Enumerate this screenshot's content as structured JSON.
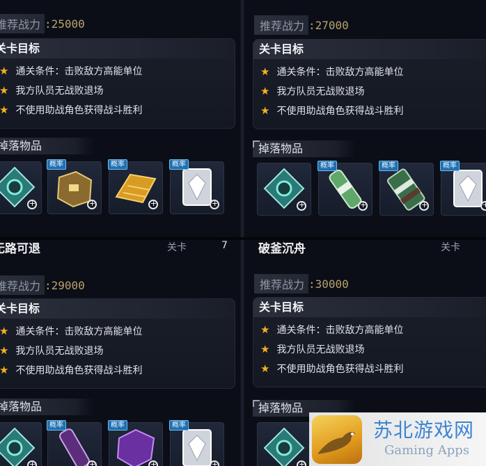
{
  "panels": [
    {
      "power_label": "推荐战力",
      "power_value": ":25000",
      "objective_title": "关卡目标",
      "objectives": [
        "通关条件：击败敌方高能单位",
        "我方队员无战败退场",
        "不使用助战角色获得战斗胜利"
      ],
      "drops_label": "掉落物品",
      "drop_items": [
        {
          "icon": "gear-chip-icon",
          "tag": ""
        },
        {
          "icon": "treasure-chest-icon",
          "tag": "概率"
        },
        {
          "icon": "gold-bars-icon",
          "tag": "概率"
        },
        {
          "icon": "crystal-card-icon",
          "tag": "概率"
        }
      ]
    },
    {
      "power_label": "推荐战力",
      "power_value": ":27000",
      "objective_title": "关卡目标",
      "objectives": [
        "通关条件：击败敌方高能单位",
        "我方队员无战败退场",
        "不使用助战角色获得战斗胜利"
      ],
      "drops_label": "掉落物品",
      "drop_items": [
        {
          "icon": "gear-chip-icon",
          "tag": ""
        },
        {
          "icon": "green-vial-icon",
          "tag": "概率"
        },
        {
          "icon": "green-module-icon",
          "tag": "概率"
        },
        {
          "icon": "crystal-card-icon",
          "tag": "概率"
        }
      ]
    },
    {
      "stage_title": "无路可退",
      "stage_tag": "关卡",
      "stage_num": "7",
      "power_label": "推荐战力",
      "power_value": ":29000",
      "objective_title": "关卡目标",
      "objectives": [
        "通关条件：击败敌方高能单位",
        "我方队员无战败退场",
        "不使用助战角色获得战斗胜利"
      ],
      "drops_label": "掉落物品",
      "drop_items": [
        {
          "icon": "gear-chip-icon",
          "tag": ""
        },
        {
          "icon": "purple-vial-icon",
          "tag": "概率"
        },
        {
          "icon": "purple-cube-icon",
          "tag": "概率"
        },
        {
          "icon": "crystal-card-icon",
          "tag": "概率"
        }
      ]
    },
    {
      "stage_title": "破釜沉舟",
      "stage_tag": "关卡",
      "power_label": "推荐战力",
      "power_value": ":30000",
      "objective_title": "关卡目标",
      "objectives": [
        "通关条件：击败敌方高能单位",
        "我方队员无战败退场",
        "不使用助战角色获得战斗胜利"
      ],
      "drops_label": "掉落物品",
      "drop_items": [
        {
          "icon": "gear-chip-icon",
          "tag": ""
        }
      ]
    }
  ],
  "watermark": {
    "title": "苏北游戏网",
    "subtitle": "Gaming Apps"
  },
  "colors": {
    "star": "#f3b41b",
    "power_value": "#b9a36d",
    "tag_bg": "#1f6fb0"
  }
}
